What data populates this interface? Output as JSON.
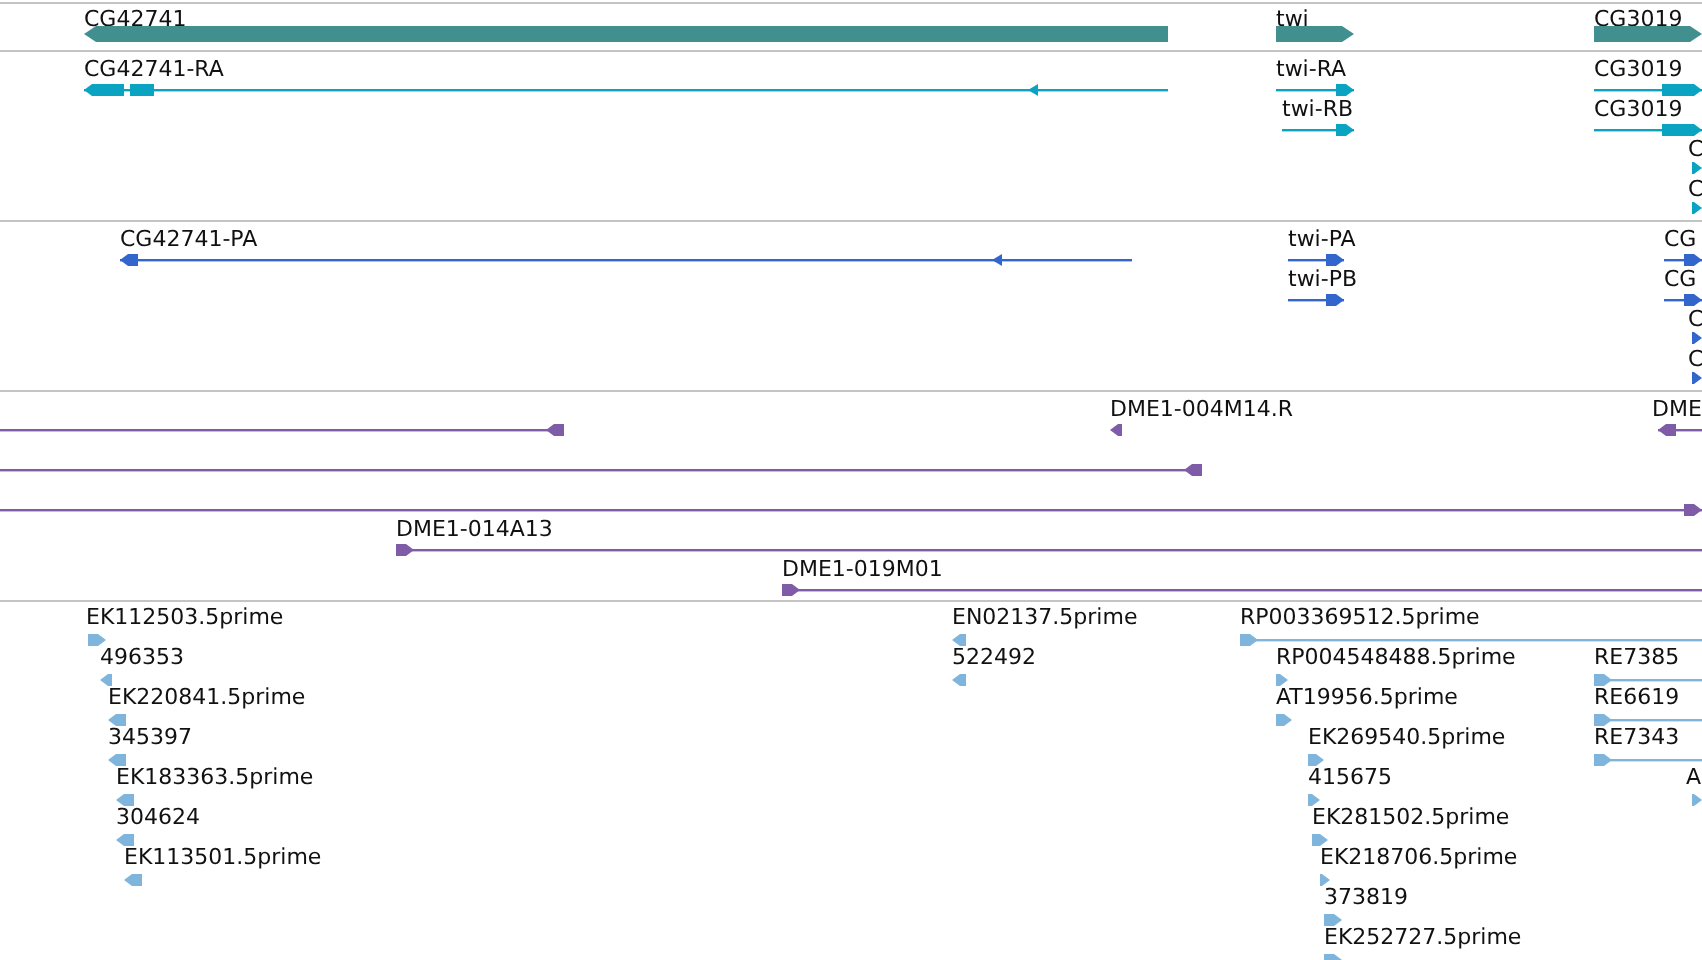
{
  "tracks": [
    {
      "kind": "gene",
      "features": [
        {
          "label": "CG42741",
          "reverse": true
        },
        {
          "label": "twi",
          "reverse": false
        },
        {
          "label": "CG3019",
          "reverse": false
        }
      ]
    },
    {
      "kind": "transcript",
      "features": [
        {
          "label": "CG42741-RA",
          "reverse": true
        },
        {
          "label": "twi-RA",
          "reverse": false
        },
        {
          "label": "twi-RB",
          "reverse": false
        },
        {
          "label": "CG3019",
          "reverse": false
        },
        {
          "label": "CG3019",
          "reverse": false
        },
        {
          "label": "C",
          "reverse": false
        },
        {
          "label": "C",
          "reverse": false
        }
      ]
    },
    {
      "kind": "protein",
      "features": [
        {
          "label": "CG42741-PA",
          "reverse": true
        },
        {
          "label": "twi-PA",
          "reverse": false
        },
        {
          "label": "twi-PB",
          "reverse": false
        },
        {
          "label": "CG",
          "reverse": false
        },
        {
          "label": "CG",
          "reverse": false
        },
        {
          "label": "C",
          "reverse": false
        },
        {
          "label": "C",
          "reverse": false
        }
      ]
    },
    {
      "kind": "clone",
      "features": [
        {
          "reverse": true
        },
        {
          "label": "DME1-004M14.R",
          "reverse": true
        },
        {
          "label": "DME",
          "reverse": true
        },
        {
          "reverse": true
        },
        {
          "reverse": false
        },
        {
          "label": "DME1-014A13",
          "reverse": false
        },
        {
          "label": "DME1-019M01",
          "reverse": false
        }
      ]
    },
    {
      "kind": "est",
      "features": [
        {
          "label": "EK112503.5prime",
          "reverse": false
        },
        {
          "label": "496353",
          "reverse": true
        },
        {
          "label": "EK220841.5prime",
          "reverse": true
        },
        {
          "label": "345397",
          "reverse": true
        },
        {
          "label": "EK183363.5prime",
          "reverse": true
        },
        {
          "label": "304624",
          "reverse": true
        },
        {
          "label": "EK113501.5prime",
          "reverse": true
        },
        {
          "label": "EN02137.5prime",
          "reverse": true
        },
        {
          "label": "522492",
          "reverse": true
        },
        {
          "label": "RP003369512.5prime",
          "reverse": false
        },
        {
          "label": "RP004548488.5prime",
          "reverse": false
        },
        {
          "label": "AT19956.5prime",
          "reverse": false
        },
        {
          "label": "EK269540.5prime",
          "reverse": false
        },
        {
          "label": "415675",
          "reverse": false
        },
        {
          "label": "EK281502.5prime",
          "reverse": false
        },
        {
          "label": "EK218706.5prime",
          "reverse": false
        },
        {
          "label": "373819",
          "reverse": false
        },
        {
          "label": "EK252727.5prime",
          "reverse": false
        },
        {
          "label": "RE7385",
          "reverse": false
        },
        {
          "label": "RE6619",
          "reverse": false
        },
        {
          "label": "RE7343",
          "reverse": false
        },
        {
          "label": "A",
          "reverse": false
        }
      ]
    }
  ]
}
